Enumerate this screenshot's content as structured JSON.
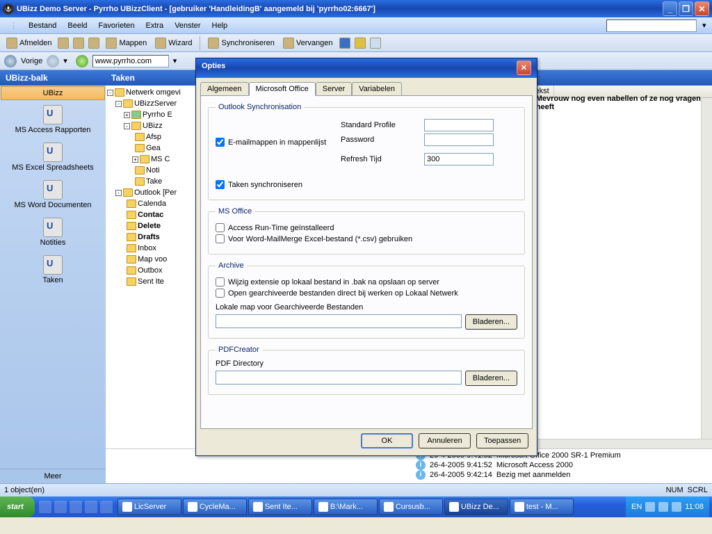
{
  "title": "UBizz Demo Server - Pyrrho UBizzClient - [gebruiker 'HandleidingB' aangemeld bij 'pyrrho02:6667']",
  "menu": [
    "Bestand",
    "Beeld",
    "Favorieten",
    "Extra",
    "Venster",
    "Help"
  ],
  "toolbar": {
    "afmelden": "Afmelden",
    "mappen": "Mappen",
    "wizard": "Wizard",
    "sync": "Synchroniseren",
    "vervangen": "Vervangen"
  },
  "nav": {
    "vorige": "Vorige",
    "url": "www.pyrrho.com"
  },
  "sidebar": {
    "header": "UBizz-balk",
    "selected": "UBizz",
    "items": [
      "MS Access Rapporten",
      "MS Excel Spreadsheets",
      "MS Word Documenten",
      "Notities",
      "Taken"
    ],
    "more": "Meer"
  },
  "content_header": "Taken",
  "tree": [
    "Netwerk omgevi",
    "UBizzServer",
    "Pyrrho E",
    "UBizz",
    "Afsp",
    "Gea",
    "MS C",
    "Noti",
    "Take",
    "Outlook [Per",
    "Calenda",
    "Contac",
    "Delete",
    "Drafts",
    "Inbox",
    "Map voo",
    "Outbox",
    "Sent Ite"
  ],
  "list_header_tekst": "Tekst",
  "list_row1": "Mevrouw nog even nabellen of ze nog vragen heeft",
  "logs": [
    {
      "t": "26-4-2005 9:41:52",
      "m": "Microsoft Office 2000 SR-1 Premium"
    },
    {
      "t": "26-4-2005 9:41:52",
      "m": "Microsoft Access 2000"
    },
    {
      "t": "26-4-2005 9:42:14",
      "m": "Bezig met aanmelden"
    }
  ],
  "status": {
    "left": "1 object(en)",
    "num": "NUM",
    "scrl": "SCRL"
  },
  "taskbar": {
    "start": "start",
    "tasks": [
      "LicServer",
      "CycleMa...",
      "Sent Ite...",
      "B:\\Mark...",
      "Cursusb...",
      "UBizz De...",
      "test - M..."
    ],
    "lang": "EN",
    "time": "11:08"
  },
  "dialog": {
    "title": "Opties",
    "tabs": [
      "Algemeen",
      "Microsoft Office",
      "Server",
      "Variabelen"
    ],
    "outlook": {
      "legend": "Outlook Synchronisation",
      "email_mappen": "E-mailmappen in mappenlijst",
      "std_profile": "Standard Profile",
      "password": "Password",
      "refresh": "Refresh Tijd",
      "refresh_val": "300",
      "taken_sync": "Taken synchroniseren"
    },
    "msoffice": {
      "legend": "MS Office",
      "access_rt": "Access Run-Time geïnstalleerd",
      "word_mm": "Voor Word-MailMerge Excel-bestand (*.csv) gebruiken"
    },
    "archive": {
      "legend": "Archive",
      "wijzig": "Wijzig extensie op lokaal bestand in .bak na opslaan op server",
      "open_gearch": "Open gearchiveerde bestanden direct bij werken op Lokaal Netwerk",
      "lokale_map": "Lokale map voor Gearchiveerde Bestanden",
      "bladeren": "Bladeren..."
    },
    "pdf": {
      "legend": "PDFCreator",
      "dir": "PDF Directory",
      "bladeren": "Bladeren..."
    },
    "buttons": {
      "ok": "OK",
      "cancel": "Annuleren",
      "apply": "Toepassen"
    }
  }
}
